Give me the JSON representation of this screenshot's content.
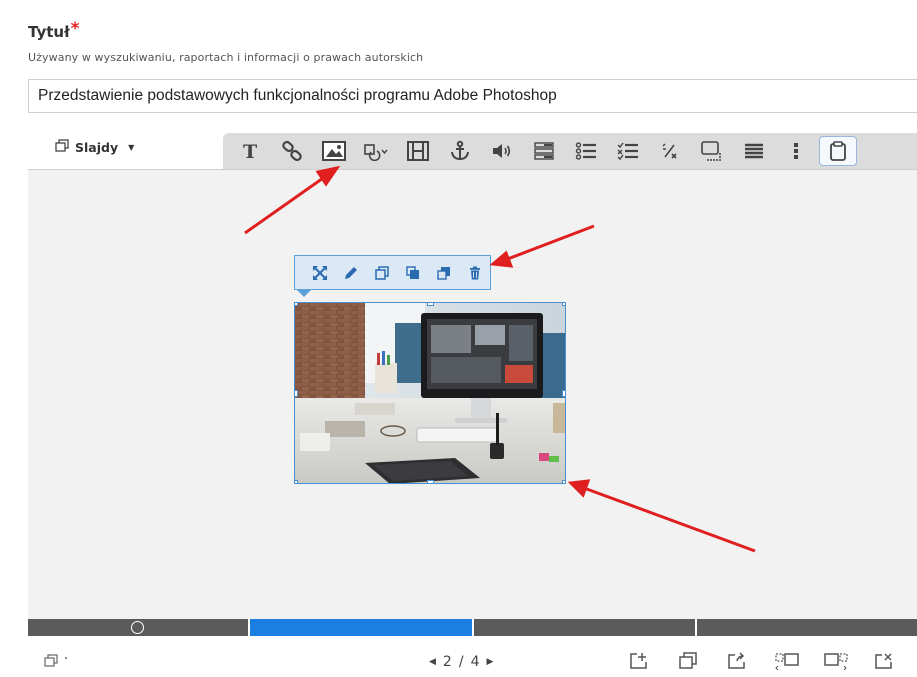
{
  "form": {
    "title_label": "Tytuł",
    "required_marker": "*",
    "helper_text": "Używany w wyszukiwaniu, raportach i informacji o prawach autorskich",
    "title_value": "Przedstawienie podstawowych funkcjonalności programu Adobe Photoshop"
  },
  "editor": {
    "slides_dropdown": {
      "label": "Slajdy",
      "icon": "slides-icon"
    },
    "toolbar_icons": [
      "text-icon",
      "link-icon",
      "image-icon",
      "shape-icon",
      "video-icon",
      "anchor-icon",
      "audio-icon",
      "form-icon",
      "list-icon",
      "checklist-icon",
      "fraction-icon",
      "hotspot-icon",
      "align-icon",
      "more-icon",
      "clipboard-icon"
    ],
    "active_toolbar_icon": "clipboard-icon",
    "image_toolbar_icons": [
      "fullscreen-icon",
      "edit-icon",
      "copy-icon",
      "bring-forward-icon",
      "send-backward-icon",
      "delete-icon"
    ]
  },
  "timeline": {
    "segments": 4,
    "active_segment": 2
  },
  "pagination": {
    "current": "2",
    "separator": "/",
    "total": "4"
  },
  "bottom_actions": [
    "add-slide-icon",
    "duplicate-slide-icon",
    "import-slide-icon",
    "slide-left-icon",
    "slide-right-icon",
    "delete-slide-icon"
  ],
  "colors": {
    "accent": "#1a7fe0",
    "selection": "#4a90d0",
    "annotation_arrow": "#e02020",
    "required": "#e02020",
    "timeline": "#5b5b5b"
  }
}
